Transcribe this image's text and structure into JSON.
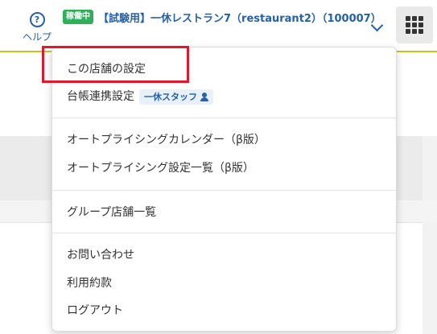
{
  "header": {
    "help_label": "ヘルプ",
    "help_icon": "question-circle-icon",
    "status_badge": "稼働中",
    "store_name": "【試験用】一休レストラン7（restaurant2）（100007）",
    "accent_color": "#2560a8",
    "status_color": "#2eb05b",
    "header_rule_color": "#c9c41c"
  },
  "menu": {
    "store_settings": "この店舗の設定",
    "ledger_settings": "台帳連携設定",
    "staff_tag": "一休スタッフ",
    "autopricing_calendar": "オートプライシングカレンダー（β版）",
    "autopricing_list": "オートプライシング設定一覧（β版）",
    "group_stores": "グループ店舗一覧",
    "contact": "お問い合わせ",
    "terms": "利用約款",
    "logout": "ログアウト"
  },
  "annotation": {
    "highlight_color": "#e0182c"
  }
}
